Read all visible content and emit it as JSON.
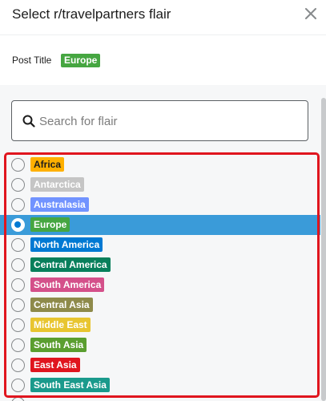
{
  "modal": {
    "title": "Select r/travelpartners flair",
    "close_icon": "close-icon"
  },
  "post": {
    "label": "Post Title",
    "flair": {
      "text": "Europe",
      "color": "#46a641"
    }
  },
  "search": {
    "placeholder": "Search for flair",
    "value": "",
    "icon": "search-icon"
  },
  "flairs": [
    {
      "text": "Africa",
      "color": "#ffb000",
      "text_color": "dark",
      "selected": false
    },
    {
      "text": "Antarctica",
      "color": "#c5c5c5",
      "text_color": "light",
      "selected": false
    },
    {
      "text": "Australasia",
      "color": "#7193ff",
      "text_color": "light",
      "selected": false
    },
    {
      "text": "Europe",
      "color": "#46a641",
      "text_color": "light",
      "selected": true
    },
    {
      "text": "North America",
      "color": "#0079d3",
      "text_color": "light",
      "selected": false
    },
    {
      "text": "Central America",
      "color": "#087f5b",
      "text_color": "light",
      "selected": false
    },
    {
      "text": "South America",
      "color": "#d4508a",
      "text_color": "light",
      "selected": false
    },
    {
      "text": "Central Asia",
      "color": "#8e8a4a",
      "text_color": "light",
      "selected": false
    },
    {
      "text": "Middle East",
      "color": "#e8c530",
      "text_color": "light",
      "selected": false
    },
    {
      "text": "South Asia",
      "color": "#5a9e2f",
      "text_color": "light",
      "selected": false
    },
    {
      "text": "East Asia",
      "color": "#e0151e",
      "text_color": "light",
      "selected": false
    },
    {
      "text": "South East Asia",
      "color": "#1a9a8c",
      "text_color": "light",
      "selected": false
    }
  ],
  "colors": {
    "selected_row": "#3a9bd9",
    "annotation": "#e0151e"
  }
}
